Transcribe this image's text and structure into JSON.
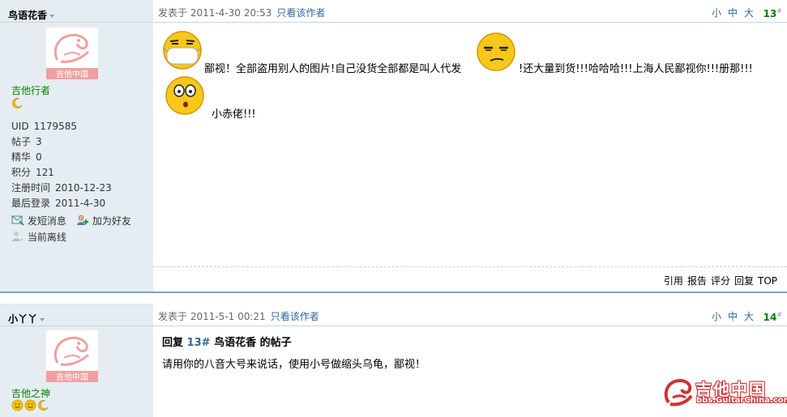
{
  "posts": [
    {
      "author": "鸟语花香",
      "avatar_caption": "吉他中国",
      "group": "吉他行者",
      "badges": [
        "moon-icon"
      ],
      "info": [
        {
          "label": "UID",
          "value": "1179585"
        },
        {
          "label": "帖子",
          "value": "3"
        },
        {
          "label": "精华",
          "value": "0"
        },
        {
          "label": "积分",
          "value": "121"
        },
        {
          "label": "注册时间",
          "value": "2010-12-23"
        },
        {
          "label": "最后登录",
          "value": "2011-4-30"
        }
      ],
      "actions": {
        "message": "发短消息",
        "friend": "加为好友",
        "status": "当前离线"
      },
      "posted_at": "发表于 2011-4-30 20:53",
      "only_author": "只看该作者",
      "font_sizes": [
        "小",
        "中",
        "大"
      ],
      "floor": "13",
      "floor_mark": "#",
      "content": {
        "line1a": "鄙视！全部盗用别人的图片!自己没货全部都是叫人代发",
        "line1b": "!还大量到货!!!哈哈哈!!!上海人民鄙视你!!!册那!!!",
        "line2": "小赤佬!!!"
      },
      "footer": [
        "引用",
        "报告",
        "评分",
        "回复",
        "TOP"
      ]
    },
    {
      "author": "小丫丫",
      "avatar_caption": "吉他中国",
      "group": "吉他之神",
      "badges": [
        "sun-icon",
        "sun-icon",
        "moon-icon"
      ],
      "posted_at": "发表于 2011-5-1 00:21",
      "only_author": "只看该作者",
      "font_sizes": [
        "小",
        "中",
        "大"
      ],
      "floor": "14",
      "floor_mark": "#",
      "reply_title_prefix": "回复",
      "reply_title_ref": "13#",
      "reply_title_suffix": "鸟语花香 的帖子",
      "reply_body": "请用你的八音大号来说话，使用小号做缩头乌龟，鄙视！"
    }
  ],
  "watermark": {
    "title": "吉他中国",
    "url": "bbs.GuitarChina.com"
  },
  "colors": {
    "sidebar": "#e5edf2",
    "border": "#c2d5e3",
    "link": "#336699",
    "group": "#008000",
    "logo_red": "#cc3333"
  }
}
